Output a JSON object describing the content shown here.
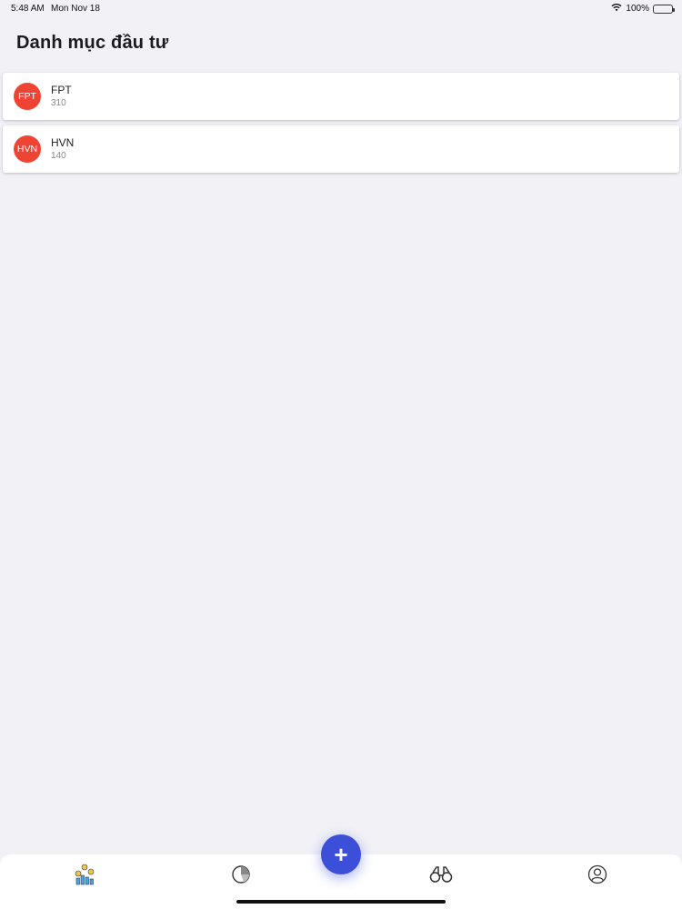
{
  "status": {
    "time": "5:48 AM",
    "date": "Mon Nov 18",
    "battery": "100%",
    "battery_level": 1.0
  },
  "header": {
    "title": "Danh mục đầu tư"
  },
  "portfolio": [
    {
      "symbol": "FPT",
      "avatar": "FPT",
      "quantity": "310",
      "avatar_color": "#ef4433"
    },
    {
      "symbol": "HVN",
      "avatar": "HVN",
      "quantity": "140",
      "avatar_color": "#ef4433"
    }
  ],
  "tabbar": {
    "tabs": [
      {
        "icon": "portfolio-coins-icon"
      },
      {
        "icon": "pie-chart-icon"
      },
      {
        "icon": "binoculars-icon"
      },
      {
        "icon": "profile-icon"
      }
    ],
    "fab_label": "+",
    "accent": "#3b4fd8"
  }
}
